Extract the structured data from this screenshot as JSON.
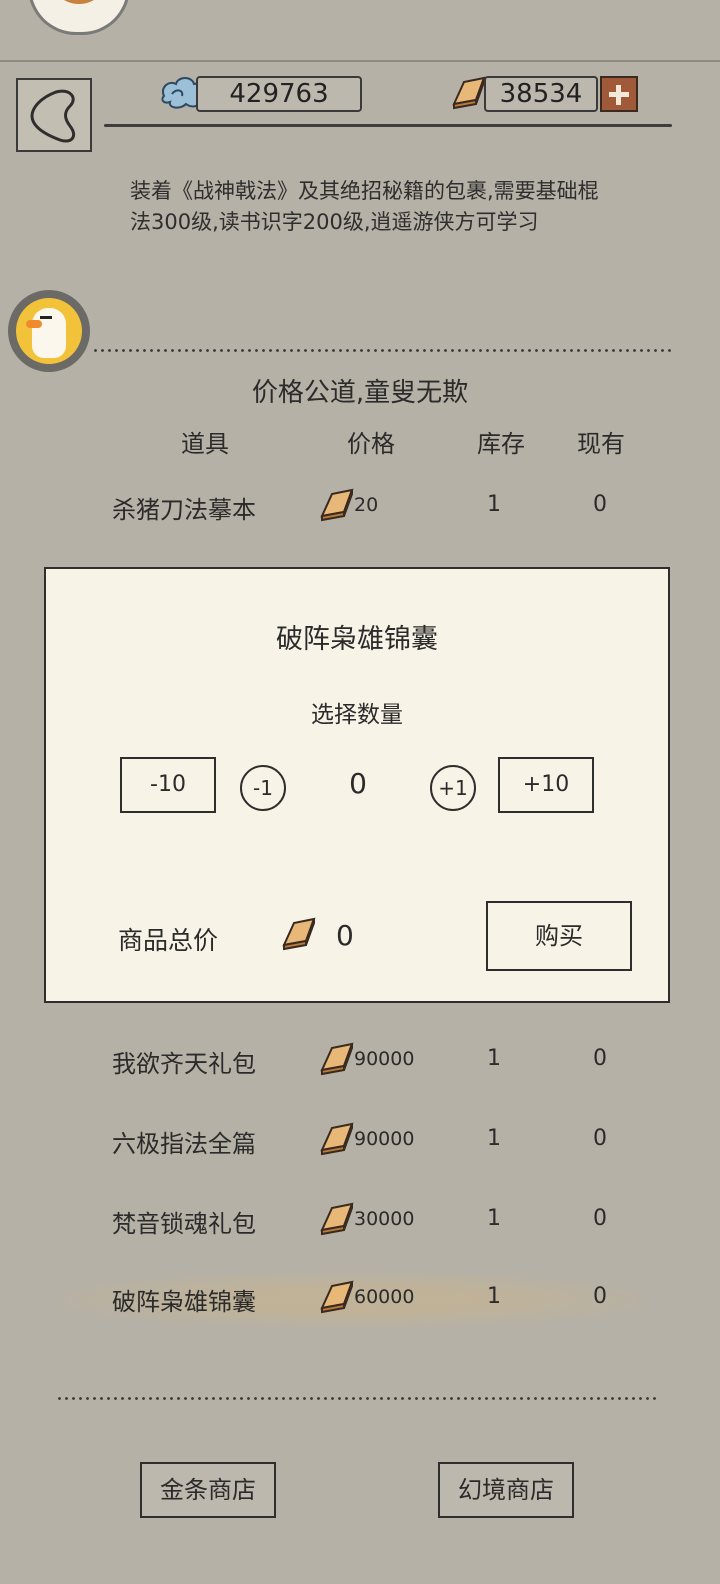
{
  "resources": {
    "silver_amount": "429763",
    "gold_amount": "38534"
  },
  "description": "装着《战神戟法》及其绝招秘籍的包裹,需要基础棍法300级,读书识字200级,逍遥游侠方可学习",
  "shop": {
    "title": "价格公道,童叟无欺",
    "columns": {
      "item": "道具",
      "price": "价格",
      "stock": "库存",
      "owned": "现有"
    },
    "items": [
      {
        "name": "杀猪刀法摹本",
        "price": "20",
        "stock": "1",
        "owned": "0"
      },
      {
        "name": "我欲齐天礼包",
        "price": "90000",
        "stock": "1",
        "owned": "0"
      },
      {
        "name": "六极指法全篇",
        "price": "90000",
        "stock": "1",
        "owned": "0"
      },
      {
        "name": "梵音锁魂礼包",
        "price": "30000",
        "stock": "1",
        "owned": "0"
      },
      {
        "name": "破阵枭雄锦囊",
        "price": "60000",
        "stock": "1",
        "owned": "0"
      }
    ]
  },
  "dialog": {
    "title": "破阵枭雄锦囊",
    "subtitle": "选择数量",
    "minus10": "-10",
    "minus1": "-1",
    "quantity": "0",
    "plus1": "+1",
    "plus10": "+10",
    "total_label": "商品总价",
    "total_value": "0",
    "buy_label": "购买"
  },
  "bottom": {
    "gold_shop": "金条商店",
    "illusion_shop": "幻境商店"
  },
  "colors": {
    "background": "#b6b1a6",
    "dialog": "#f7f3e6",
    "gold": "#d9a15a",
    "plus": "#a05a3a"
  },
  "icons": [
    "back-icon",
    "silver-cloud-icon",
    "gold-bar-icon",
    "plus-icon",
    "duck-avatar-icon"
  ]
}
